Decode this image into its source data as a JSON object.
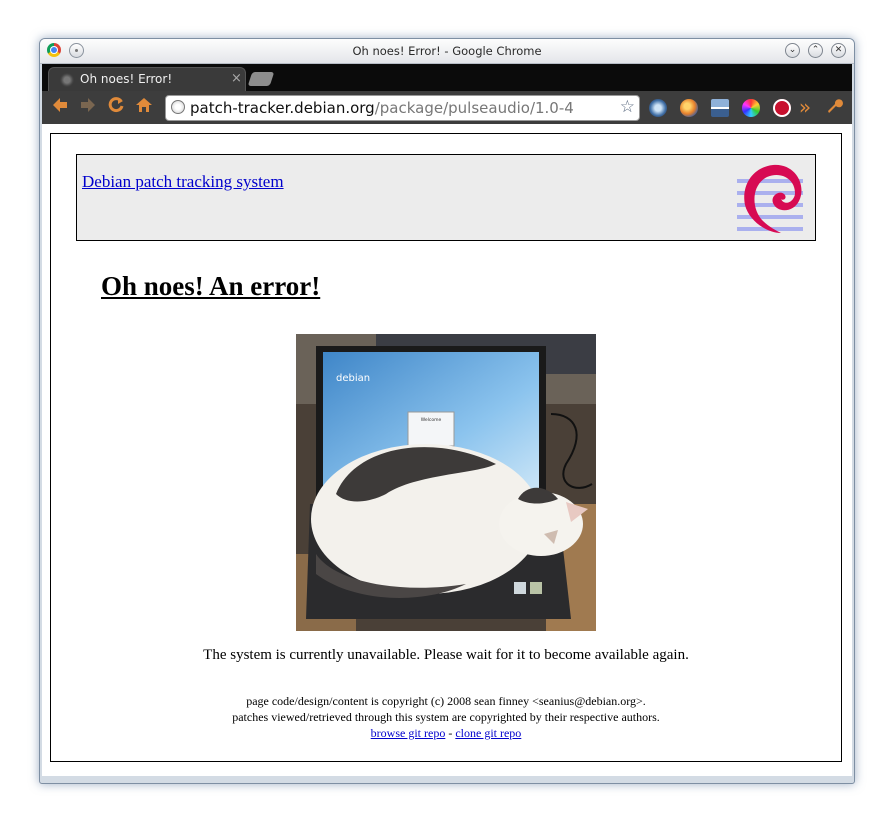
{
  "window": {
    "title": "Oh noes! Error! - Google Chrome"
  },
  "tab": {
    "title": "Oh noes! Error!",
    "close_glyph": "×"
  },
  "toolbar": {
    "url_host": "patch-tracker.debian.org",
    "url_path": "/package/pulseaudio/1.0-4",
    "overflow_glyph": "»",
    "icons": [
      "back-icon",
      "forward-icon",
      "reload-icon",
      "home-icon",
      "bookmark-star-icon",
      "extension-icon",
      "wrench-icon"
    ]
  },
  "page": {
    "header_link": "Debian patch tracking system",
    "error_title": "Oh noes! An error!",
    "message": "The system is currently unavailable. Please wait for it to become available again.",
    "footer_line1": "page code/design/content is copyright (c) 2008 sean finney <seanius@debian.org>.",
    "footer_line2": "patches viewed/retrieved through this system are copyrighted by their respective authors.",
    "browse_link": "browse git repo",
    "separator": " - ",
    "clone_link": "clone git repo",
    "photo_screen_brand": "debian",
    "photo_dialog_title": "Welcome"
  },
  "colors": {
    "link": "#0000cc",
    "header_bg": "#ececec",
    "debian_red": "#d70a53",
    "toolbar_bg": "#3d3d3d"
  }
}
